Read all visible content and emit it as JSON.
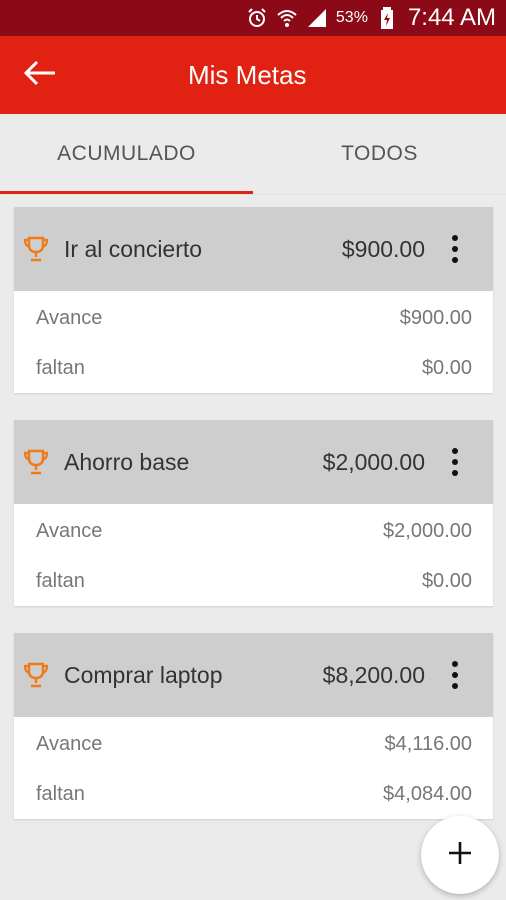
{
  "status_bar": {
    "battery_pct": "53%",
    "time": "7:44 AM"
  },
  "app_bar": {
    "title": "Mis Metas"
  },
  "tabs": [
    {
      "label": "ACUMULADO",
      "active": true
    },
    {
      "label": "TODOS",
      "active": false
    }
  ],
  "goals": [
    {
      "name": "Ir al concierto",
      "amount": "$900.00",
      "advance_label": "Avance",
      "advance_value": "$900.00",
      "remaining_label": "faltan",
      "remaining_value": "$0.00"
    },
    {
      "name": "Ahorro base",
      "amount": "$2,000.00",
      "advance_label": "Avance",
      "advance_value": "$2,000.00",
      "remaining_label": "faltan",
      "remaining_value": "$0.00"
    },
    {
      "name": "Comprar laptop",
      "amount": "$8,200.00",
      "advance_label": "Avance",
      "advance_value": "$4,116.00",
      "remaining_label": "faltan",
      "remaining_value": "$4,084.00"
    }
  ],
  "icons": {
    "back": "arrow-left-icon",
    "goal": "trophy-icon",
    "menu": "more-vert-icon",
    "fab": "plus-icon"
  },
  "colors": {
    "primary": "#e12111",
    "status_bar": "#8c0a17",
    "trophy": "#f07a18",
    "card_header": "#cecece"
  }
}
